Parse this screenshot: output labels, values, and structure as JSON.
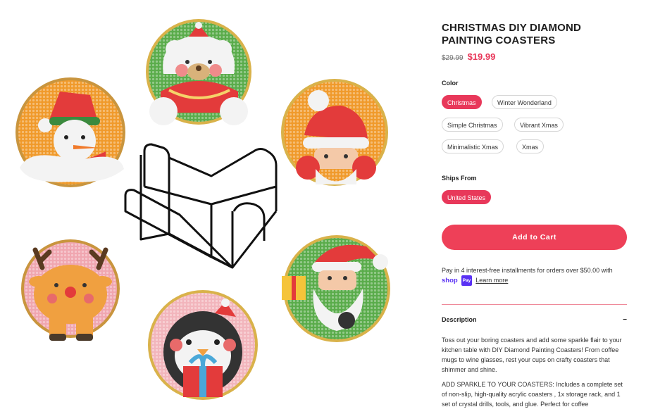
{
  "product": {
    "title": "CHRISTMAS DIY DIAMOND PAINTING COASTERS",
    "old_price": "$29.99",
    "price": "$19.99"
  },
  "options": {
    "color_label": "Color",
    "colors": [
      "Christmas",
      "Winter Wonderland",
      "Simple Christmas",
      "Vibrant Xmas",
      "Minimalistic Xmas",
      "Xmas"
    ],
    "selected_color": "Christmas",
    "ships_label": "Ships From",
    "ships": [
      "United States"
    ]
  },
  "cart": {
    "label": "Add to Cart"
  },
  "installments": {
    "text": "Pay in 4 interest-free installments for orders over $50.00 with",
    "shop_text": "shop",
    "pay_text": "Pay",
    "learn_more": "Learn more"
  },
  "description": {
    "heading": "Description",
    "toggle": "−",
    "p1": "Toss out your boring coasters and add some sparkle flair to your kitchen table with DIY Diamond Painting Coasters! From coffee mugs to wine glasses, rest your cups on crafty coasters that shimmer and shine.",
    "p2": "ADD SPARKLE TO YOUR COASTERS: Includes a complete set of non-slip, high-quality acrylic coasters , 1x storage rack, and 1 set of crystal drills, tools, and glue. Perfect for coffee"
  },
  "colors": {
    "accent": "#e8385a",
    "button": "#ee4058",
    "shop_purple": "#5a31f4"
  },
  "gallery": {
    "coasters": [
      "polar-bear",
      "snowman",
      "santa",
      "reindeer",
      "penguin",
      "santa-gift"
    ],
    "rack": "metal-stand"
  }
}
